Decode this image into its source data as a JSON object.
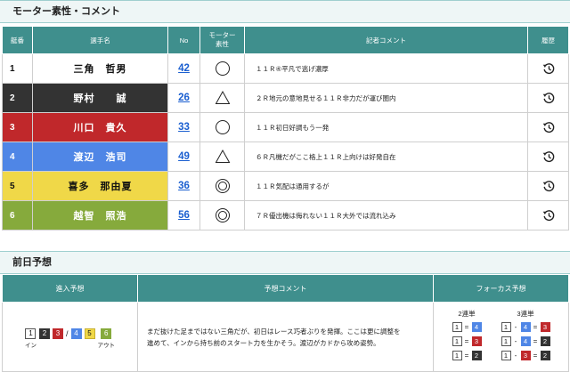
{
  "motor_section": {
    "title": "モーター素性・コメント",
    "headers": {
      "order": "艇番",
      "player": "選手名",
      "no": "No",
      "motor": "モーター\n素性",
      "comment": "記者コメント",
      "history": "履歴"
    },
    "rows": [
      {
        "num": "1",
        "name": "三角　哲男",
        "motor_no": "42",
        "mark": "circle",
        "comment": "１１Ｒ④平凡で逃げ濃厚",
        "color": "white"
      },
      {
        "num": "2",
        "name": "野村　　誠",
        "motor_no": "26",
        "mark": "triangle",
        "comment": "２Ｒ地元の意地見せる１１Ｒ非力だが運び圏内",
        "color": "black"
      },
      {
        "num": "3",
        "name": "川口　貴久",
        "motor_no": "33",
        "mark": "circle",
        "comment": "１１Ｒ初日好調もう一発",
        "color": "red"
      },
      {
        "num": "4",
        "name": "渡辺　浩司",
        "motor_no": "49",
        "mark": "triangle",
        "comment": "６Ｒ凡機だがここ格上１１Ｒ上向けは好発自在",
        "color": "blue"
      },
      {
        "num": "5",
        "name": "喜多　那由夏",
        "motor_no": "36",
        "mark": "double-circle",
        "comment": "１１Ｒ気配は通用するが",
        "color": "yellow"
      },
      {
        "num": "6",
        "name": "越智　照浩",
        "motor_no": "56",
        "mark": "double-circle",
        "comment": "７Ｒ優出機は侮れない１１Ｒ大外では流れ込み",
        "color": "green"
      }
    ]
  },
  "prediction_section": {
    "title": "前日予想",
    "headers": {
      "entry": "進入予想",
      "comment": "予想コメント",
      "focus": "フォーカス予想"
    },
    "entry": {
      "boats": [
        {
          "n": "1",
          "sub": "イン"
        },
        {
          "n": "2",
          "sub": ""
        },
        {
          "n": "3",
          "sub": ""
        },
        {
          "sep": "/"
        },
        {
          "n": "4",
          "sub": ""
        },
        {
          "n": "5",
          "sub": ""
        },
        {
          "n": "6",
          "sub": "アウト"
        }
      ]
    },
    "comment_lines": [
      "まだ抜けた足まではない三角だが、初日はレース巧者ぶりを発揮。ここは更に調整を",
      "進めて、インから持ち前のスタート力を生かそう。渡辺がカドから攻め姿勢。"
    ],
    "focus": {
      "two": {
        "label": "2連単",
        "rows": [
          [
            "1",
            "=",
            "4"
          ],
          [
            "1",
            "=",
            "3"
          ],
          [
            "1",
            "=",
            "2"
          ]
        ]
      },
      "three": {
        "label": "3連単",
        "rows": [
          [
            "1",
            "-",
            "4",
            "=",
            "3"
          ],
          [
            "1",
            "-",
            "4",
            "=",
            "2"
          ],
          [
            "1",
            "-",
            "3",
            "=",
            "2"
          ]
        ]
      }
    }
  }
}
